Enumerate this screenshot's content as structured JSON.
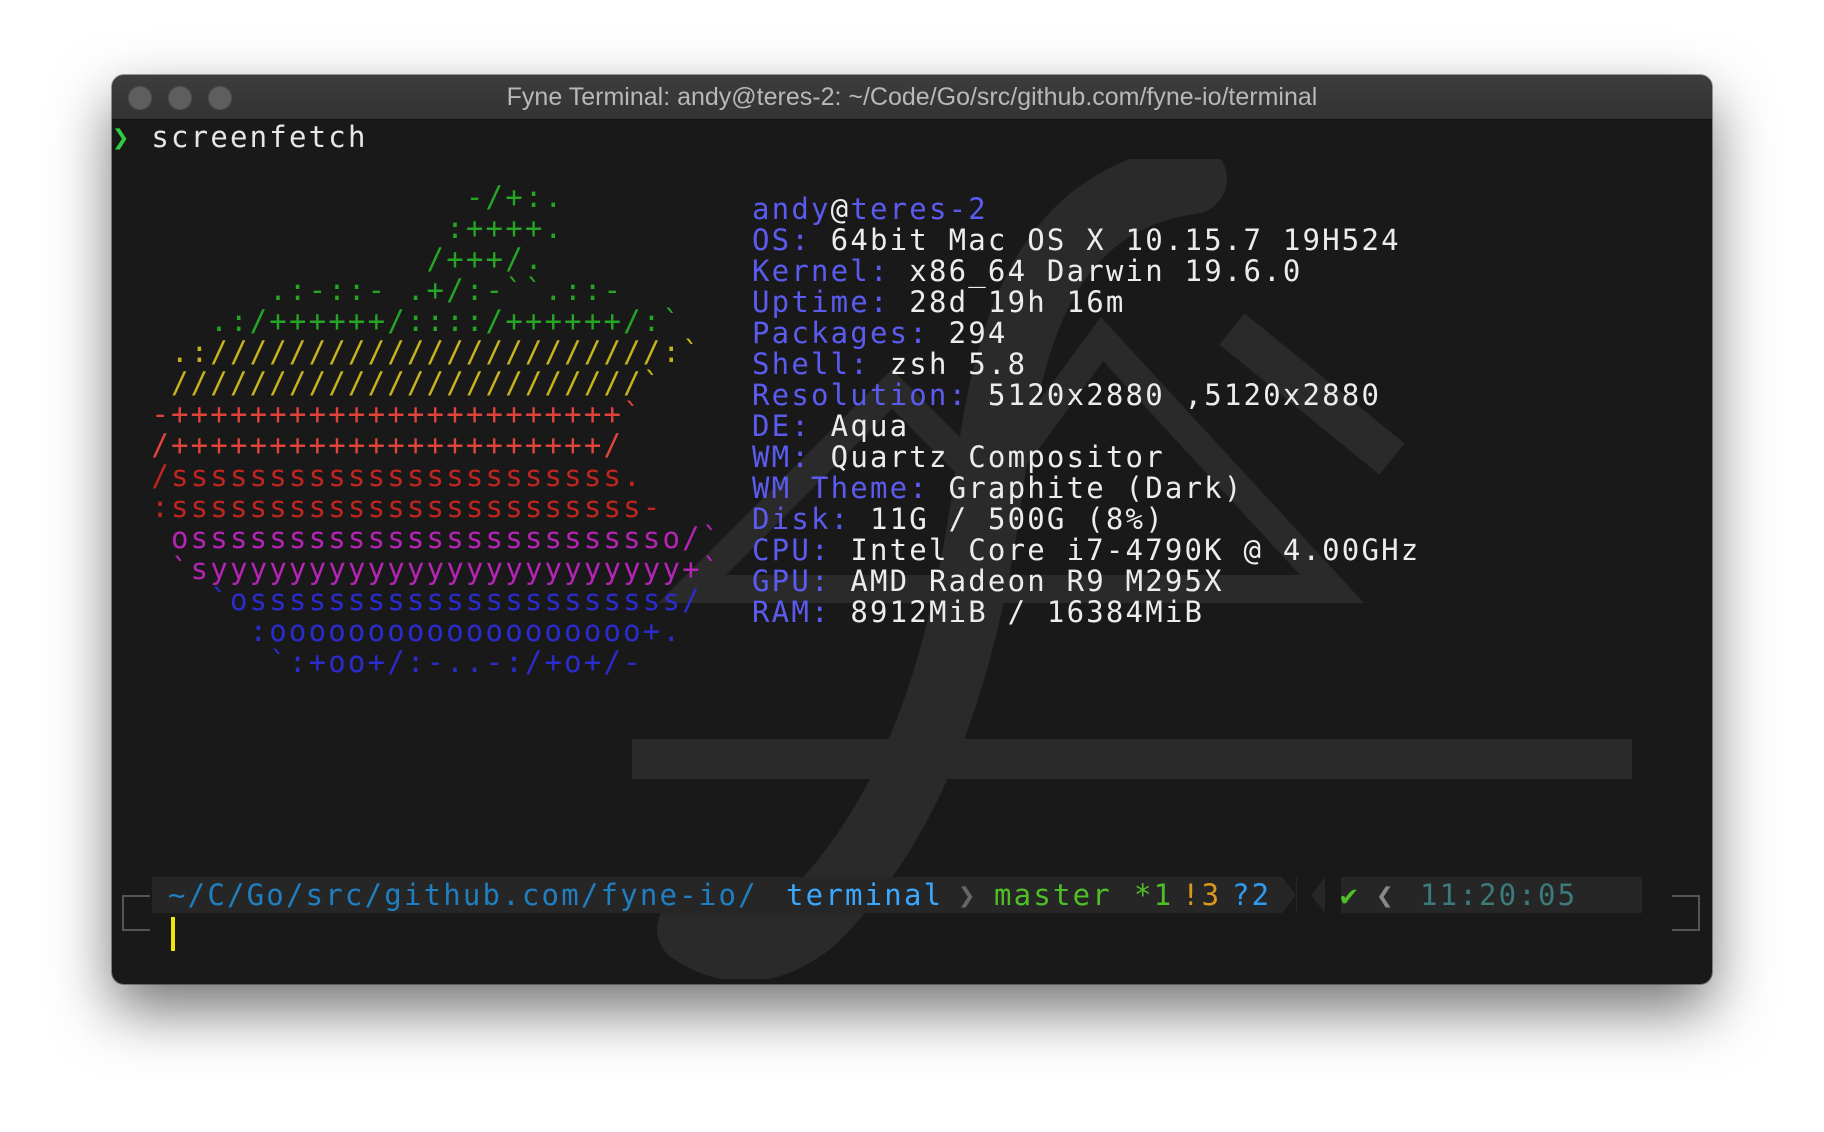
{
  "window": {
    "title": "Fyne Terminal: andy@teres-2: ~/Code/Go/src/github.com/fyne-io/terminal"
  },
  "command": {
    "prompt": "❯",
    "text": "screenfetch"
  },
  "ascii_art": [
    {
      "text": "                  -/+:.",
      "color": "#24a524"
    },
    {
      "text": "                 :++++.",
      "color": "#24a524"
    },
    {
      "text": "                /+++/.",
      "color": "#24a524"
    },
    {
      "text": "        .:-::- .+/:-``.::-",
      "color": "#24a524"
    },
    {
      "text": "     .:/++++++/::::/++++++/:`",
      "color": "#24a524"
    },
    {
      "text": "   .:///////////////////////:`",
      "color": "#c7b31a"
    },
    {
      "text": "   ////////////////////////`",
      "color": "#c7b31a"
    },
    {
      "text": "  -+++++++++++++++++++++++`",
      "color": "#e2443c"
    },
    {
      "text": "  /++++++++++++++++++++++/",
      "color": "#e2443c"
    },
    {
      "text": "  /sssssssssssssssssssssss.",
      "color": "#c0251f"
    },
    {
      "text": "  :ssssssssssssssssssssssss-",
      "color": "#c0251f"
    },
    {
      "text": "   osssssssssssssssssssssssso/`",
      "color": "#b524b5"
    },
    {
      "text": "   `syyyyyyyyyyyyyyyyyyyyyyyy+`",
      "color": "#b524b5"
    },
    {
      "text": "     `ossssssssssssssssssssss/",
      "color": "#2b2bd0"
    },
    {
      "text": "       :ooooooooooooooooooo+.",
      "color": "#2b2bd0"
    },
    {
      "text": "        `:+oo+/:-..-:/+o+/-",
      "color": "#2b2bd0"
    }
  ],
  "sysinfo": {
    "user": "andy",
    "at": "@",
    "host": "teres-2",
    "rows": [
      {
        "key": "OS:",
        "value": "64bit Mac OS X 10.15.7 19H524"
      },
      {
        "key": "Kernel:",
        "value": "x86_64 Darwin 19.6.0"
      },
      {
        "key": "Uptime:",
        "value": "28d 19h 16m"
      },
      {
        "key": "Packages:",
        "value": "294"
      },
      {
        "key": "Shell:",
        "value": "zsh 5.8"
      },
      {
        "key": "Resolution:",
        "value": "5120x2880 ,5120x2880"
      },
      {
        "key": "DE:",
        "value": "Aqua"
      },
      {
        "key": "WM:",
        "value": "Quartz Compositor"
      },
      {
        "key": "WM Theme:",
        "value": "Graphite (Dark)"
      },
      {
        "key": "Disk:",
        "value": "11G / 500G (8%)"
      },
      {
        "key": "CPU:",
        "value": "Intel Core i7-4790K @ 4.00GHz"
      },
      {
        "key": "GPU:",
        "value": "AMD Radeon R9 M295X"
      },
      {
        "key": "RAM:",
        "value": "8912MiB / 16384MiB"
      }
    ]
  },
  "prompt_bar": {
    "path_prefix": "~/C/Go/src/github.com/fyne-io/",
    "path_dir": "terminal",
    "separator": "❯",
    "git_branch": "master",
    "git_staged": "*1",
    "git_modified": "!3",
    "git_untracked": "?2",
    "status_check": "✔",
    "time_separator": "❮",
    "time": "11:20:05"
  },
  "colors": {
    "key": "#5b5bf0",
    "path": "#1f7fc0",
    "path_dir": "#3ba8ff",
    "git_branch": "#4fbf26",
    "git_modified": "#d99a1c",
    "git_untracked": "#2e9cf0",
    "time": "#3b7b7b",
    "cursor": "#f2e30a"
  }
}
